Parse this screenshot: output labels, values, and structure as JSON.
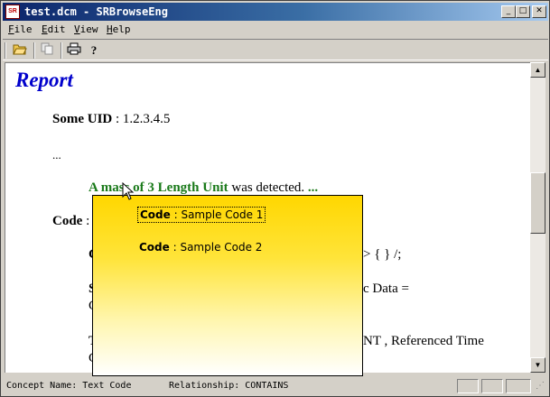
{
  "window": {
    "title": "test.dcm - SRBrowseEng",
    "app_icon_text": "SR",
    "controls": {
      "minimize": "_",
      "maximize": "□",
      "close": "✕"
    }
  },
  "menu": {
    "items": [
      {
        "label": "File",
        "accel": "F",
        "rest": "ile"
      },
      {
        "label": "Edit",
        "accel": "E",
        "rest": "dit"
      },
      {
        "label": "View",
        "accel": "V",
        "rest": "iew"
      },
      {
        "label": "Help",
        "accel": "H",
        "rest": "elp"
      }
    ]
  },
  "toolbar": {
    "buttons": [
      {
        "name": "open-folder-icon",
        "glyph": "📂"
      },
      {
        "name": "copy-icon",
        "glyph": "⎘"
      },
      {
        "name": "print-icon",
        "glyph": "🖶"
      },
      {
        "name": "help-icon",
        "glyph": "?"
      }
    ]
  },
  "report": {
    "title": "Report",
    "uid_label": "Some UID",
    "uid_value": " : 1.2.3.4.5",
    "ellipsis": "...",
    "detection": {
      "highlight": "A mass of 3 Length Unit",
      "rest": " was detected.",
      "more": "..."
    },
    "code_label": "Code",
    "code_sep": " :",
    "partial_lines": {
      "line_c1": "C",
      "line_c1_tail": "> { } /;",
      "line_s": "S",
      "line_s_tail": "c Data =",
      "line_c2": "C",
      "line_t": "T",
      "line_t_tail": "NT , Referenced Time",
      "line_c3": "C"
    }
  },
  "popup": {
    "items": [
      {
        "label": "Code",
        "value": " : Sample Code 1",
        "selected": true
      },
      {
        "label": "Code",
        "value": " : Sample Code 2",
        "selected": false
      }
    ]
  },
  "status": {
    "concept": "Concept Name: Text Code",
    "relationship": "Relationship: CONTAINS"
  },
  "colors": {
    "title_bar_start": "#0a246a",
    "report_title": "#0000cc",
    "highlight_green": "#1a7a1a",
    "popup_top": "#ffd700"
  }
}
